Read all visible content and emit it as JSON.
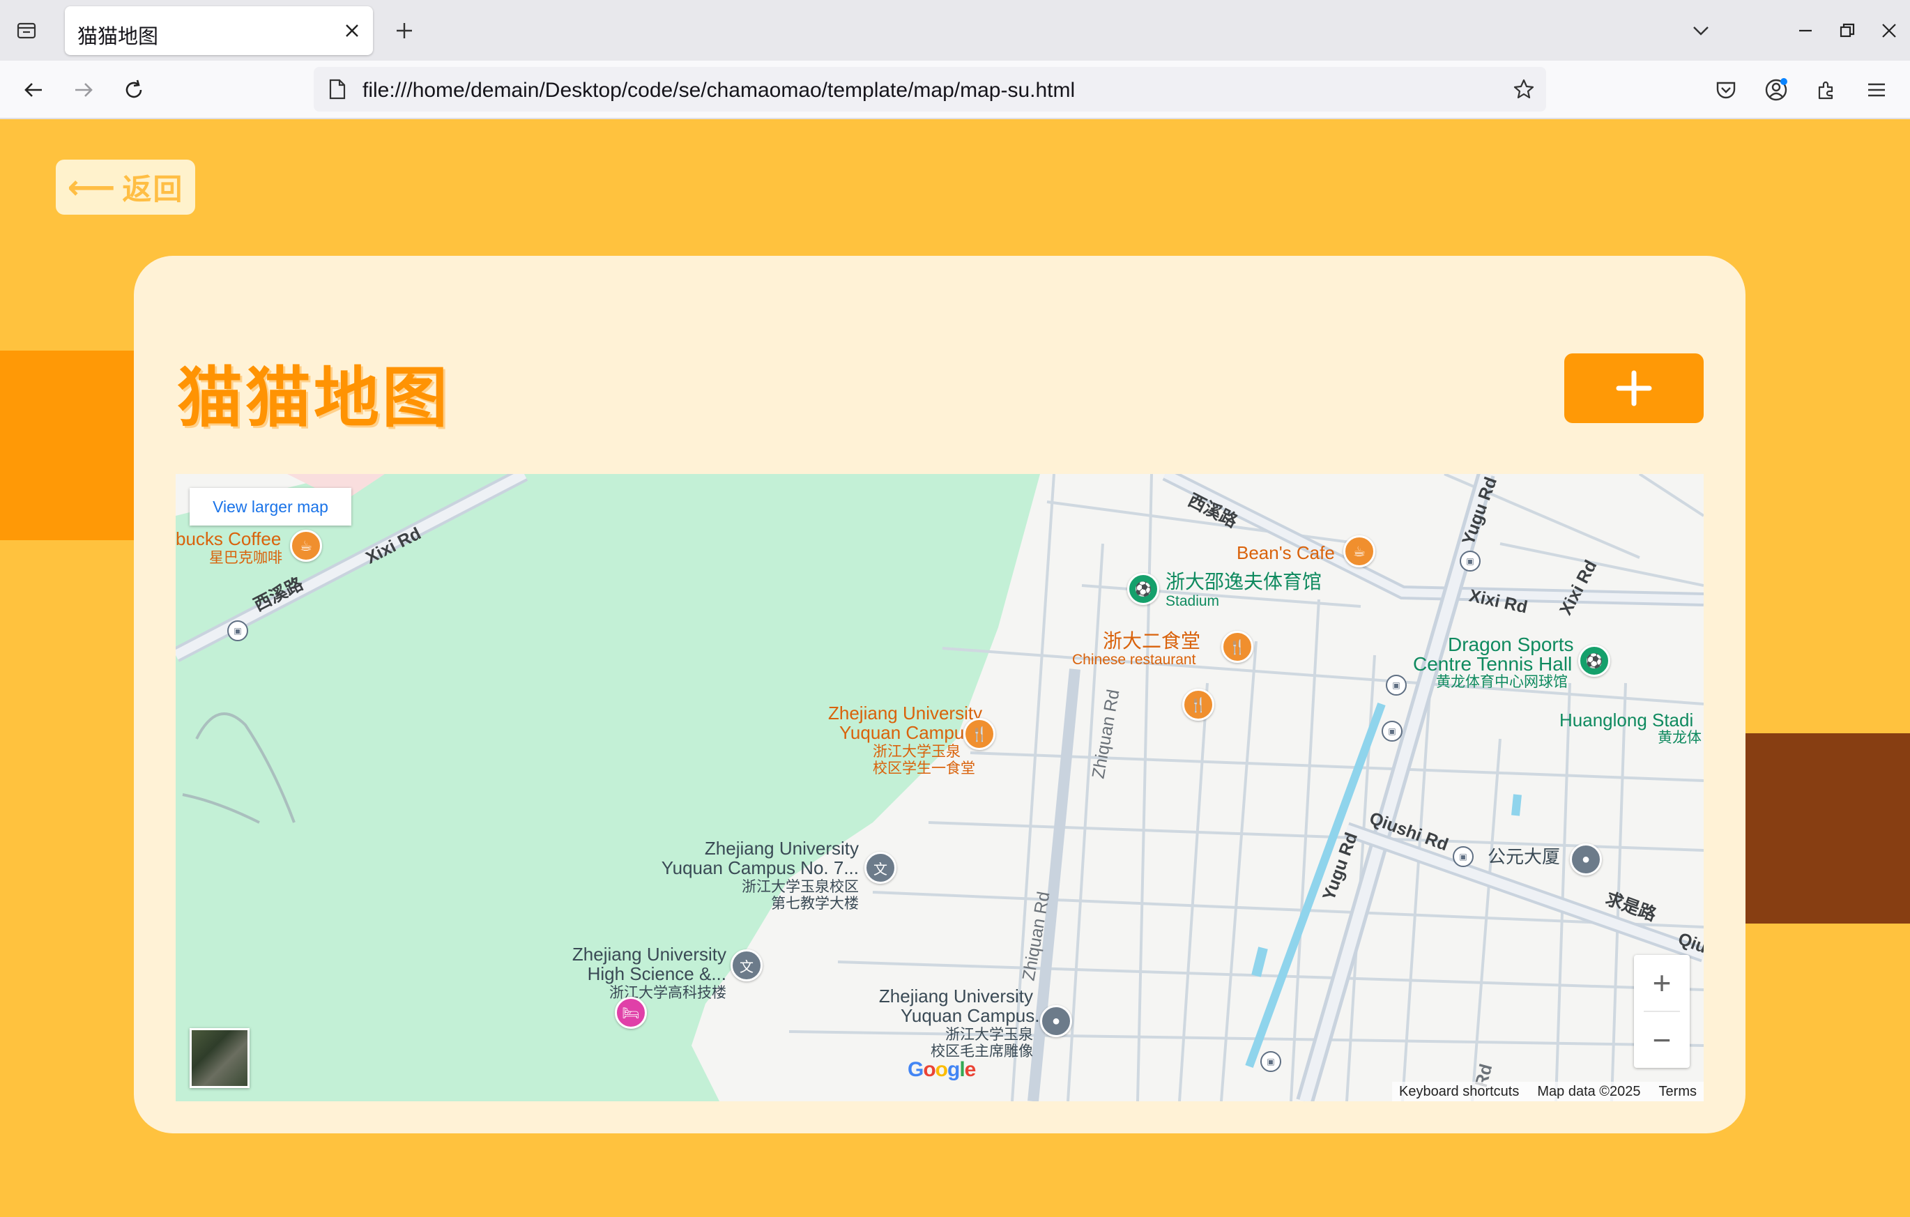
{
  "browser": {
    "tab_title": "猫猫地图",
    "url": "file:///home/demain/Desktop/code/se/chamaomao/template/map/map-su.html"
  },
  "page": {
    "back_label": "返回",
    "title": "猫猫地图",
    "add_button_icon": "plus-icon"
  },
  "map": {
    "view_larger_map": "View larger map",
    "roads": {
      "xixi_rd": "Xixi Rd",
      "xixi_rd_cn": "西溪路",
      "xixi_rd_cn_2": "西溪路",
      "xixi_rd_2": "Xixi Rd",
      "xixi_rd_3": "Xixi Rd",
      "yugu_rd": "Yugu Rd",
      "yugu_rd_2": "Yugu Rd",
      "zhiquan_rd": "Zhiquan Rd",
      "zhiquan_rd_2": "Zhiquan Rd",
      "qiushi_rd": "Qiushi Rd",
      "qiushi_rd_cn": "求是路",
      "qiu": "Qiu",
      "rd_bottom": "Rd"
    },
    "pois": {
      "starbucks": "bucks Coffee",
      "starbucks_cn": "星巴克咖啡",
      "beans_cafe": "Bean's Cafe",
      "stadium_cn": "浙大邵逸夫体育馆",
      "stadium": "Stadium",
      "canteen2_cn": "浙大二食堂",
      "canteen2_sub": "Chinese restaurant",
      "dragon_sports_1": "Dragon Sports",
      "dragon_sports_2": "Centre Tennis Hall",
      "dragon_sports_cn": "黄龙体育中心网球馆",
      "huanglong": "Huanglong Stadi",
      "huanglong_cn": "黄龙体",
      "zju_canteen_1": "Zhejiang University",
      "zju_canteen_2": "Yuquan Campus...",
      "zju_canteen_cn1": "浙江大学玉泉",
      "zju_canteen_cn2": "校区学生一食堂",
      "zju_no7_1": "Zhejiang University",
      "zju_no7_2": "Yuquan Campus No. 7...",
      "zju_no7_cn1": "浙江大学玉泉校区",
      "zju_no7_cn2": "第七教学大楼",
      "gongyuan": "公元大厦",
      "zju_hs_1": "Zhejiang University",
      "zju_hs_2": "High Science &...",
      "zju_hs_cn": "浙江大学高科技楼",
      "zju_mao_1": "Zhejiang University",
      "zju_mao_2": "Yuquan Campus...",
      "zju_mao_cn1": "浙江大学玉泉",
      "zju_mao_cn2": "校区毛主席雕像"
    },
    "zoom_in": "+",
    "zoom_out": "−",
    "google": "Google",
    "attribution": {
      "shortcuts": "Keyboard shortcuts",
      "data": "Map data ©2025",
      "terms": "Terms"
    }
  },
  "colors": {
    "page_bg": "#ffc23e",
    "card_bg": "#fff2d6",
    "accent_orange": "#ff9906",
    "brown": "#873e12",
    "park_green": "#c3f0d6"
  }
}
